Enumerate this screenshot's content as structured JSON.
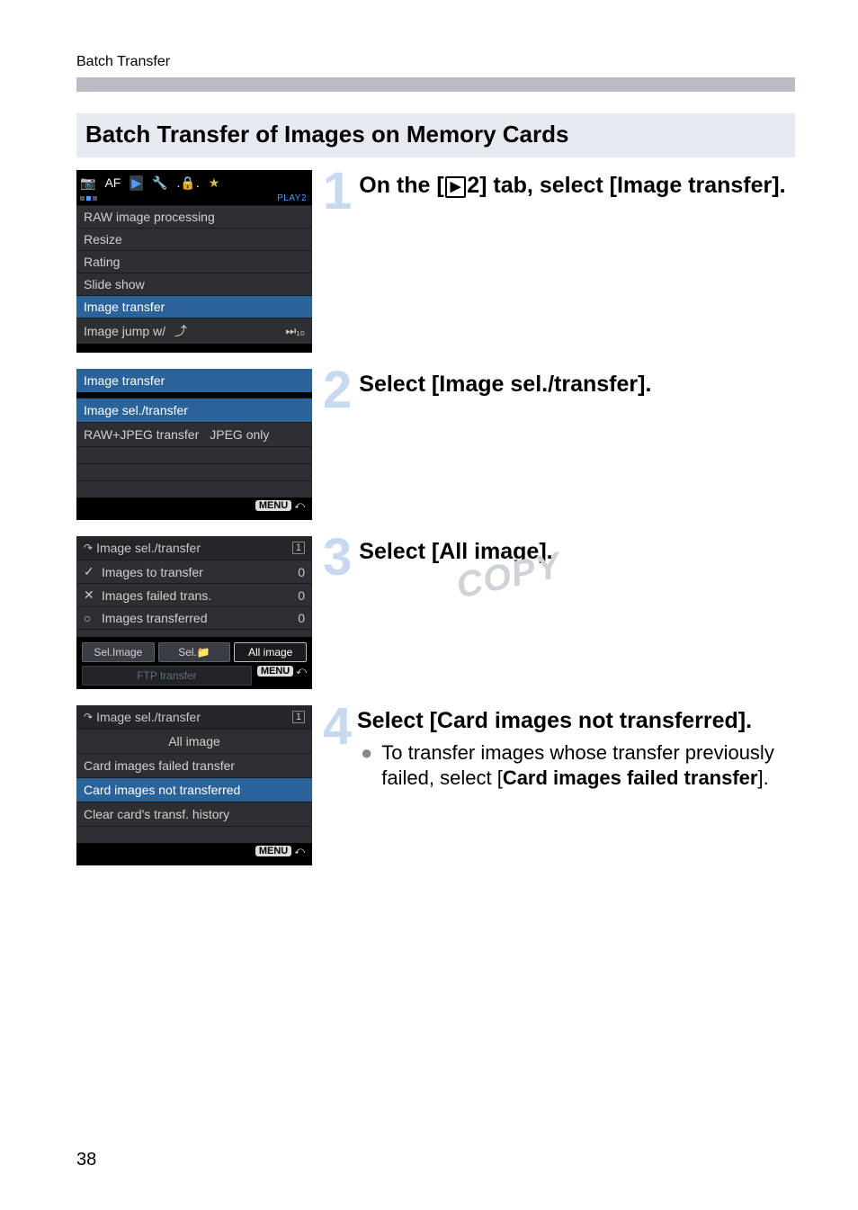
{
  "running_header": "Batch Transfer",
  "section_title": "Batch Transfer of Images on Memory Cards",
  "play_icon": "▶",
  "steps": {
    "s1": {
      "num": "1",
      "pre": "On the [",
      "tab_num": "2",
      "post": "] tab, select [Image transfer]."
    },
    "s2": {
      "num": "2",
      "text": "Select [Image sel./transfer]."
    },
    "s3": {
      "num": "3",
      "text": "Select [All image]."
    },
    "s4": {
      "num": "4",
      "text": "Select [Card images not transferred].",
      "sub_plain1": "To transfer images whose transfer previously failed, select [",
      "sub_bold": "Card images failed transfer",
      "sub_plain2": "]."
    }
  },
  "screen1": {
    "subtab_label": "PLAY2",
    "items": [
      "RAW image processing",
      "Resize",
      "Rating",
      "Slide show",
      "Image transfer"
    ],
    "jump_label": "Image jump w/",
    "jump_icon": "⤴",
    "jump_value_icon": "⏭₁₀"
  },
  "screen2": {
    "title": "Image transfer",
    "row1": "Image sel./transfer",
    "row2_label": "RAW+JPEG transfer",
    "row2_value": "JPEG only"
  },
  "screen3": {
    "title_arrow": "↷",
    "title": "Image sel./transfer",
    "card": "1",
    "rows": [
      {
        "sym": "✓",
        "label": "Images to transfer",
        "num": "0"
      },
      {
        "sym": "✕",
        "label": "Images failed trans.",
        "num": "0"
      },
      {
        "sym": "○",
        "label": "Images transferred",
        "num": "0"
      }
    ],
    "btn1": "Sel.Image",
    "btn2_pre": "Sel.",
    "btn2_icon": "📁",
    "btn3": "All image",
    "ftp": "FTP transfer"
  },
  "screen4": {
    "title_arrow": "↷",
    "title": "Image sel./transfer",
    "card": "1",
    "subtitle": "All image",
    "rows": [
      "Card images failed transfer",
      "Card images not transferred",
      "Clear card's transf. history"
    ]
  },
  "menu_return": {
    "badge": "MENU",
    "arrow": "⤺"
  },
  "page_num": "38",
  "watermark": "COPY"
}
